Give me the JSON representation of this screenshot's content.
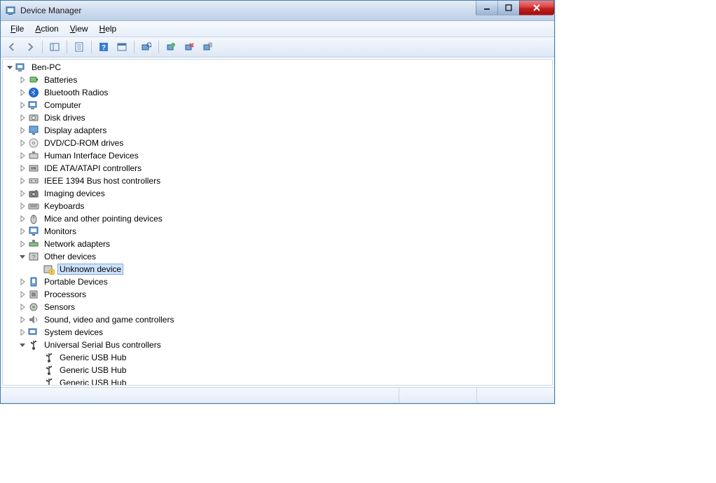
{
  "window": {
    "title": "Device Manager"
  },
  "menu": {
    "file": "File",
    "action": "Action",
    "view": "View",
    "help": "Help"
  },
  "tree": {
    "root": "Ben-PC",
    "items": [
      {
        "label": "Batteries",
        "icon": "battery",
        "exp": "closed"
      },
      {
        "label": "Bluetooth Radios",
        "icon": "bluetooth",
        "exp": "closed"
      },
      {
        "label": "Computer",
        "icon": "computer",
        "exp": "closed"
      },
      {
        "label": "Disk drives",
        "icon": "disk",
        "exp": "closed"
      },
      {
        "label": "Display adapters",
        "icon": "display",
        "exp": "closed"
      },
      {
        "label": "DVD/CD-ROM drives",
        "icon": "dvd",
        "exp": "closed"
      },
      {
        "label": "Human Interface Devices",
        "icon": "hid",
        "exp": "closed"
      },
      {
        "label": "IDE ATA/ATAPI controllers",
        "icon": "ide",
        "exp": "closed"
      },
      {
        "label": "IEEE 1394 Bus host controllers",
        "icon": "ieee",
        "exp": "closed"
      },
      {
        "label": "Imaging devices",
        "icon": "imaging",
        "exp": "closed"
      },
      {
        "label": "Keyboards",
        "icon": "keyboard",
        "exp": "closed"
      },
      {
        "label": "Mice and other pointing devices",
        "icon": "mouse",
        "exp": "closed"
      },
      {
        "label": "Monitors",
        "icon": "monitor",
        "exp": "closed"
      },
      {
        "label": "Network adapters",
        "icon": "network",
        "exp": "closed"
      },
      {
        "label": "Other devices",
        "icon": "other",
        "exp": "open",
        "children": [
          {
            "label": "Unknown device",
            "icon": "unknown",
            "selected": true
          }
        ]
      },
      {
        "label": "Portable Devices",
        "icon": "portable",
        "exp": "closed"
      },
      {
        "label": "Processors",
        "icon": "cpu",
        "exp": "closed"
      },
      {
        "label": "Sensors",
        "icon": "sensor",
        "exp": "closed"
      },
      {
        "label": "Sound, video and game controllers",
        "icon": "sound",
        "exp": "closed"
      },
      {
        "label": "System devices",
        "icon": "system",
        "exp": "closed"
      },
      {
        "label": "Universal Serial Bus controllers",
        "icon": "usb",
        "exp": "open",
        "children": [
          {
            "label": "Generic USB Hub",
            "icon": "usbdev"
          },
          {
            "label": "Generic USB Hub",
            "icon": "usbdev"
          },
          {
            "label": "Generic USB Hub",
            "icon": "usbdev"
          }
        ]
      }
    ]
  }
}
